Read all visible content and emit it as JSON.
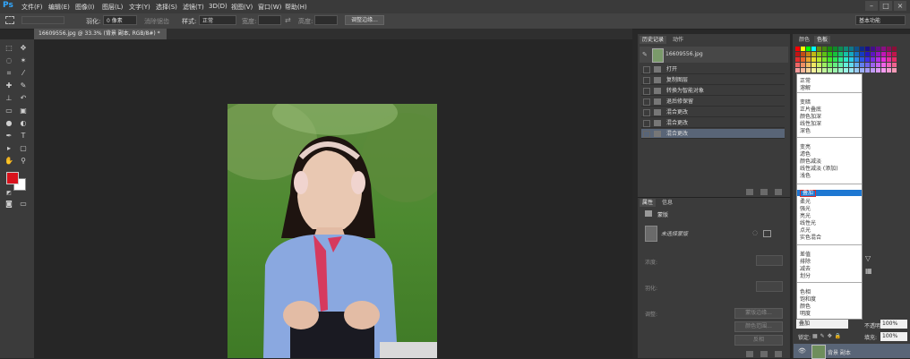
{
  "app": {
    "logo": "Ps"
  },
  "menu": [
    "文件(F)",
    "编辑(E)",
    "图像(I)",
    "图层(L)",
    "文字(Y)",
    "选择(S)",
    "滤镜(T)",
    "3D(D)",
    "视图(V)",
    "窗口(W)",
    "帮助(H)"
  ],
  "window_controls": [
    "–",
    "□",
    "×"
  ],
  "options": {
    "feather_label": "羽化:",
    "feather_value": "0 像素",
    "antialias_label": "消除锯齿",
    "style_label": "样式:",
    "style_value": "正常",
    "width_label": "宽度:",
    "height_label": "高度:",
    "refine_edge": "调整边缘...",
    "workspace": "基本功能"
  },
  "document": {
    "tab_title": "16609556.jpg @ 33.3% (背景 副本, RGB/8#) *",
    "tab_close": "×"
  },
  "history_panel": {
    "tabs": [
      "历史记录",
      "动作"
    ],
    "snapshot": "16609556.jpg",
    "items": [
      "打开",
      "复制图层",
      "转换为智能对象",
      "退后修保留",
      "混合更改",
      "混合更改",
      "混合更改"
    ]
  },
  "properties_panel": {
    "tabs": [
      "属性",
      "信息"
    ],
    "header": "蒙版",
    "mask_label": "未选择蒙版",
    "density_label": "浓度:",
    "feather_label": "羽化:",
    "adjust_label": "调整:",
    "btn_mask_edge": "蒙版边缘...",
    "btn_color_range": "颜色范围...",
    "btn_invert": "反相"
  },
  "color_panel": {
    "tabs": [
      "颜色",
      "色板"
    ]
  },
  "blend_modes": {
    "groups": [
      [
        "正常",
        "溶解"
      ],
      [
        "变暗",
        "正片叠底",
        "颜色加深",
        "线性加深",
        "深色"
      ],
      [
        "变亮",
        "滤色",
        "颜色减淡",
        "线性减淡 (添加)",
        "浅色"
      ],
      [
        "叠加",
        "柔光",
        "强光",
        "亮光",
        "线性光",
        "点光",
        "实色混合"
      ],
      [
        "差值",
        "排除",
        "减去",
        "划分"
      ],
      [
        "色相",
        "饱和度",
        "颜色",
        "明度"
      ]
    ],
    "selected": "叠加"
  },
  "layers_panel": {
    "blend_value": "叠加",
    "opacity_label": "不透明度:",
    "opacity_value": "100%",
    "lock_label": "锁定:",
    "fill_label": "填充:",
    "fill_value": "100%",
    "layer_name": "背景 副本"
  },
  "colors": {
    "foreground": "#d8121c",
    "background": "#ffffff",
    "accent": "#1e78d2"
  }
}
